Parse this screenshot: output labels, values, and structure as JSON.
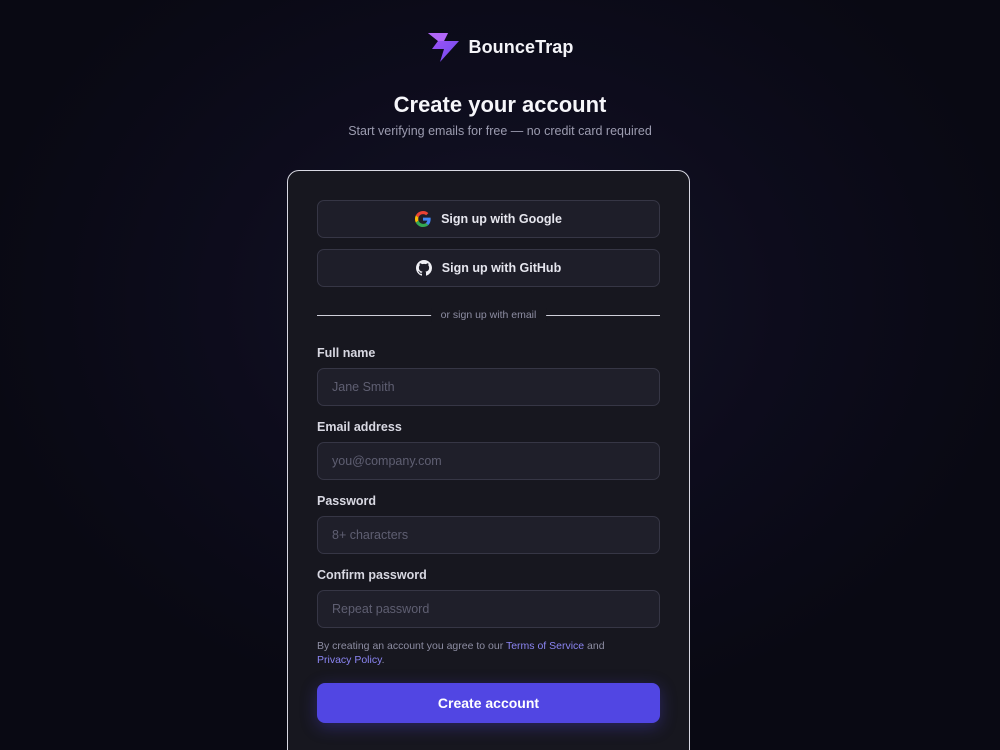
{
  "brand": {
    "name": "BounceTrap",
    "logo_icon": "lightning-bolt-icon",
    "logo_colors": [
      "#a855f7",
      "#6366f1"
    ]
  },
  "header": {
    "title": "Create your account",
    "subtitle": "Start verifying emails for free — no credit card required"
  },
  "oauth": {
    "google": {
      "label": "Sign up with Google",
      "icon": "google-icon"
    },
    "github": {
      "label": "Sign up with GitHub",
      "icon": "github-icon"
    }
  },
  "divider": {
    "text": "or sign up with email"
  },
  "form": {
    "full_name": {
      "label": "Full name",
      "placeholder": "Jane Smith",
      "value": ""
    },
    "email": {
      "label": "Email address",
      "placeholder": "you@company.com",
      "value": ""
    },
    "password": {
      "label": "Password",
      "placeholder": "8+ characters",
      "value": ""
    },
    "confirm_password": {
      "label": "Confirm password",
      "placeholder": "Repeat password",
      "value": ""
    }
  },
  "terms": {
    "prefix": "By creating an account you agree to our ",
    "tos_link": "Terms of Service",
    "middle": " and",
    "privacy_link": "Privacy Policy",
    "suffix": "."
  },
  "submit": {
    "label": "Create account"
  },
  "colors": {
    "accent": "#5146e3",
    "link": "#8b85f2",
    "background": "#0d0c1c",
    "card": "#17171f"
  }
}
